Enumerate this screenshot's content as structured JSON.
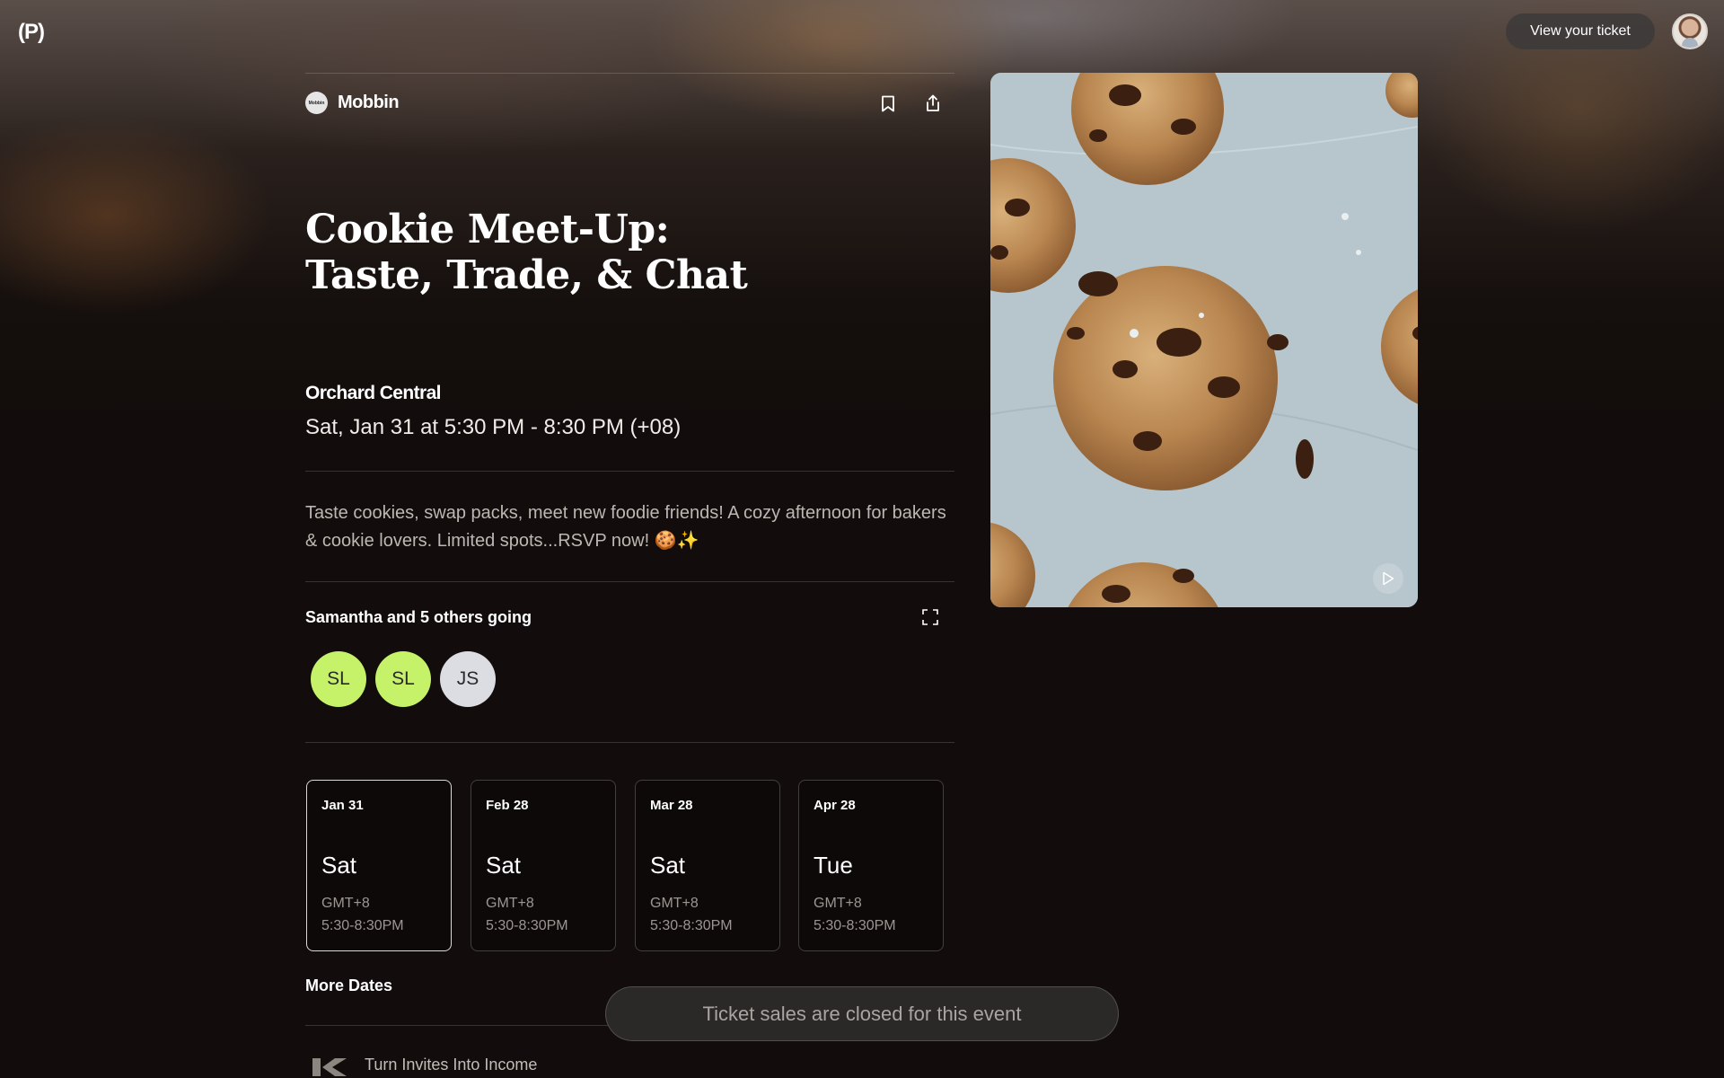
{
  "header": {
    "logo_text": "(P)",
    "view_ticket_label": "View your ticket"
  },
  "organizer": {
    "logo_text": "Mobbin",
    "name": "Mobbin"
  },
  "event": {
    "title_line1": "Cookie Meet-Up:",
    "title_line2": "Taste, Trade, & Chat",
    "venue": "Orchard Central",
    "datetime": "Sat, Jan 31 at 5:30 PM - 8:30 PM (+08)",
    "description": "Taste cookies, swap packs, meet new foodie friends! A cozy afternoon for bakers & cookie lovers. Limited spots...RSVP now! 🍪✨"
  },
  "attendees": {
    "summary": "Samantha and 5 others going",
    "avatars": [
      {
        "initials": "SL",
        "color": "#c6f26a"
      },
      {
        "initials": "SL",
        "color": "#c6f26a"
      },
      {
        "initials": "JS",
        "color": "#dcdde2"
      }
    ]
  },
  "dates": [
    {
      "date": "Jan 31",
      "day": "Sat",
      "tz": "GMT+8",
      "time": "5:30-8:30PM",
      "selected": true
    },
    {
      "date": "Feb 28",
      "day": "Sat",
      "tz": "GMT+8",
      "time": "5:30-8:30PM",
      "selected": false
    },
    {
      "date": "Mar 28",
      "day": "Sat",
      "tz": "GMT+8",
      "time": "5:30-8:30PM",
      "selected": false
    },
    {
      "date": "Apr 28",
      "day": "Tue",
      "tz": "GMT+8",
      "time": "5:30-8:30PM",
      "selected": false
    }
  ],
  "more_dates_label": "More Dates",
  "footer": {
    "promo_text": "Turn Invites Into Income"
  },
  "ticket_status": "Ticket sales are closed for this event",
  "colors": {
    "background": "#120d0c",
    "accent_green": "#c6f26a"
  }
}
